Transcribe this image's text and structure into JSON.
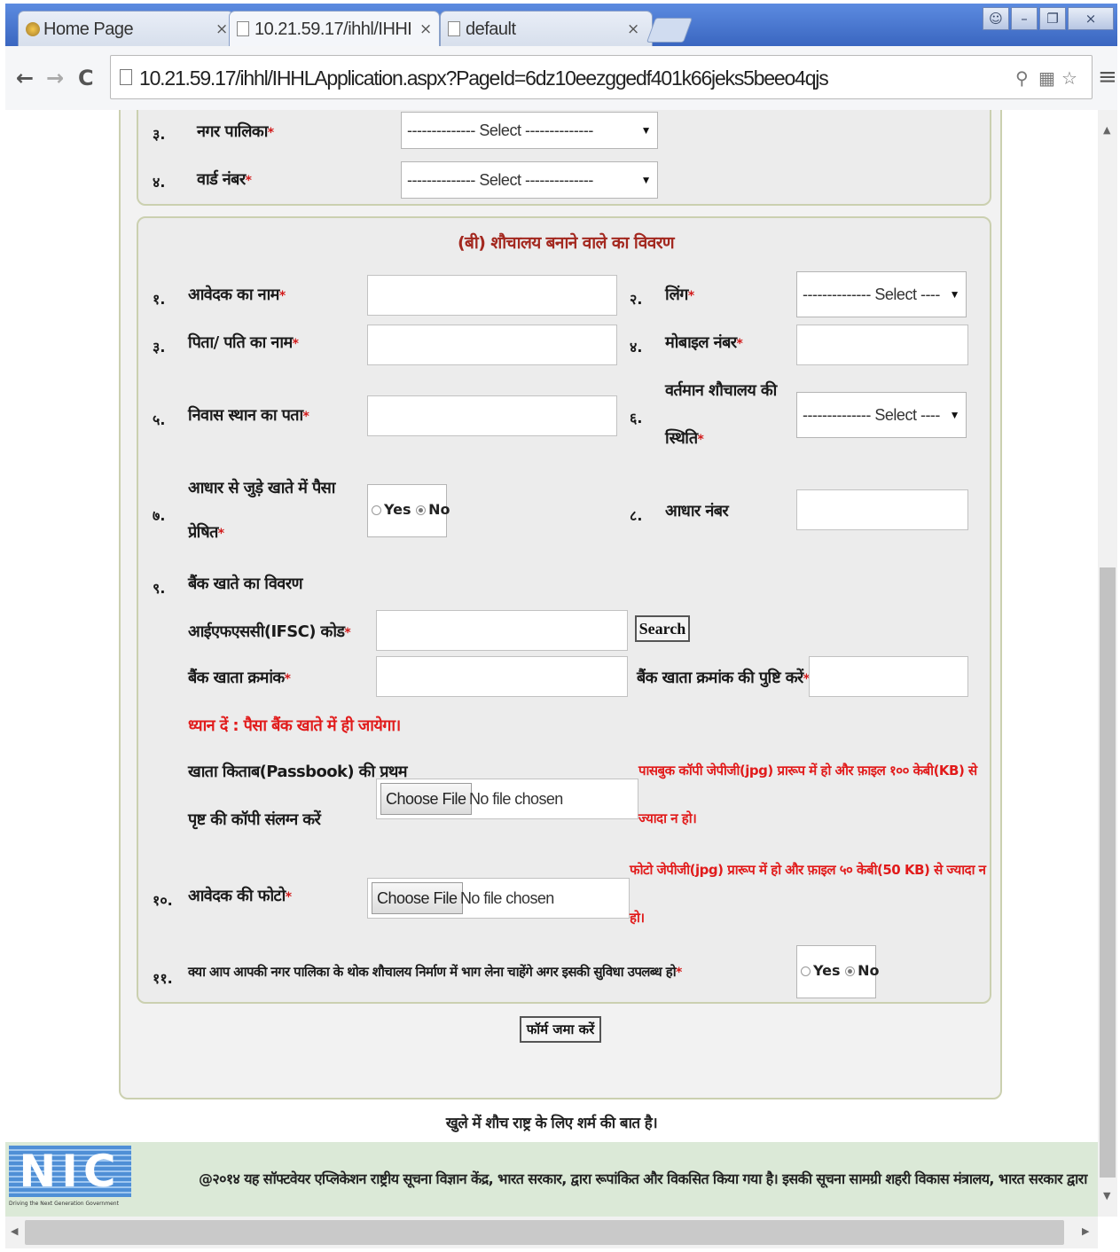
{
  "browser": {
    "tabs": [
      {
        "title": "Home Page"
      },
      {
        "title": "10.21.59.17/ihhl/IHHL"
      },
      {
        "title": "default"
      }
    ],
    "url": "10.21.59.17/ihhl/IHHLApplication.aspx?PageId=6dz10eezggedf401k66jeks5beeo4qjs"
  },
  "location": {
    "fields": [
      {
        "num": "३.",
        "label": "नगर पालिका",
        "required": "*",
        "value": "-------------- Select --------------"
      },
      {
        "num": "४.",
        "label": "वार्ड नंबर",
        "required": "*",
        "value": "-------------- Select --------------"
      }
    ]
  },
  "form": {
    "title": "(बी) शौचालय बनाने वाले का विवरण",
    "applicant_name": {
      "num": "१.",
      "label": "आवेदक का नाम",
      "required": "*",
      "value": ""
    },
    "gender": {
      "num": "२.",
      "label": "लिंग",
      "required": "*",
      "value": "-------------- Select ----"
    },
    "father_name": {
      "num": "३.",
      "label": "पिता/ पति का नाम",
      "required": "*",
      "value": ""
    },
    "mobile": {
      "num": "४.",
      "label": "मोबाइल नंबर",
      "required": "*",
      "value": ""
    },
    "address": {
      "num": "५.",
      "label": "निवास स्थान का पता",
      "required": "*",
      "value": ""
    },
    "toilet_status": {
      "num": "६.",
      "label_line1": "वर्तमान शौचालय की",
      "label_line2": "स्थिति",
      "required": "*",
      "value": "-------------- Select ----"
    },
    "aadhaar_linked": {
      "num": "७.",
      "label_line1": "आधार से जुड़े खाते में पैसा",
      "label_line2": "प्रेषित",
      "required": "*",
      "yes": "Yes",
      "no": "No",
      "selected": "No"
    },
    "aadhaar_number": {
      "num": "८.",
      "label": "आधार नंबर",
      "value": ""
    },
    "bank_details": {
      "num": "९.",
      "label": "बैंक खाते का विवरण"
    },
    "ifsc": {
      "label": "आईएफएससी(IFSC) कोड",
      "required": "*",
      "value": "",
      "search_label": "Search"
    },
    "account_number": {
      "label": "बैंक खाता क्रमांक",
      "required": "*",
      "value": ""
    },
    "confirm_account": {
      "label": "बैंक खाता क्रमांक की पुष्टि करें",
      "required": "*",
      "value": ""
    },
    "bank_note": "ध्यान दें : पैसा बैंक खाते में ही जायेगा।",
    "passbook": {
      "label_line1": "खाता किताब(Passbook) की प्रथम",
      "label_line2": "पृष्ट की कॉपी संलग्न करें",
      "choose_label": "Choose File",
      "file_status": "No file chosen",
      "note_line1": "पासबुक कॉपी जेपीजी(jpg) प्रारूप में हो और फ़ाइल १०० केबी(KB) से",
      "note_line2": "ज्यादा न हो।"
    },
    "photo": {
      "num": "१०.",
      "label": "आवेदक की फोटो",
      "required": "*",
      "choose_label": "Choose File",
      "file_status": "No file chosen",
      "note_line1": "फोटो जेपीजी(jpg) प्रारूप में हो और फ़ाइल ५० केबी(50 KB) से ज्यादा न",
      "note_line2": "हो।"
    },
    "community_toilet": {
      "num": "११.",
      "label": "क्या आप आपकी नगर पालिका के थोक शौचालय निर्माण में भाग लेना चाहेंगे अगर इसकी सुविधा उपलब्ध हो",
      "required": "*",
      "yes": "Yes",
      "no": "No",
      "selected": "No"
    },
    "submit_label": "फॉर्म जमा करें"
  },
  "footer": {
    "slogan": "खुले में शौच राष्ट्र के लिए शर्म की बात है।",
    "logo_text": "NIC",
    "logo_tagline": "Driving the Next Generation Government",
    "text": "@२०१४ यह सॉफ्टवेयर एप्लिकेशन राष्ट्रीय सूचना विज्ञान केंद्र, भारत सरकार, द्वारा रूपांकित और विकसित किया गया है। इसकी सूचना सामग्री शहरी विकास मंत्रालय, भारत सरकार द्वारा"
  },
  "colors": {
    "panel_border": "#cbd0b0",
    "section_title": "#a3281f",
    "note_red": "#e11b1b",
    "footer_bg": "#dbe9d7",
    "tabbar": "#3a66c0"
  }
}
